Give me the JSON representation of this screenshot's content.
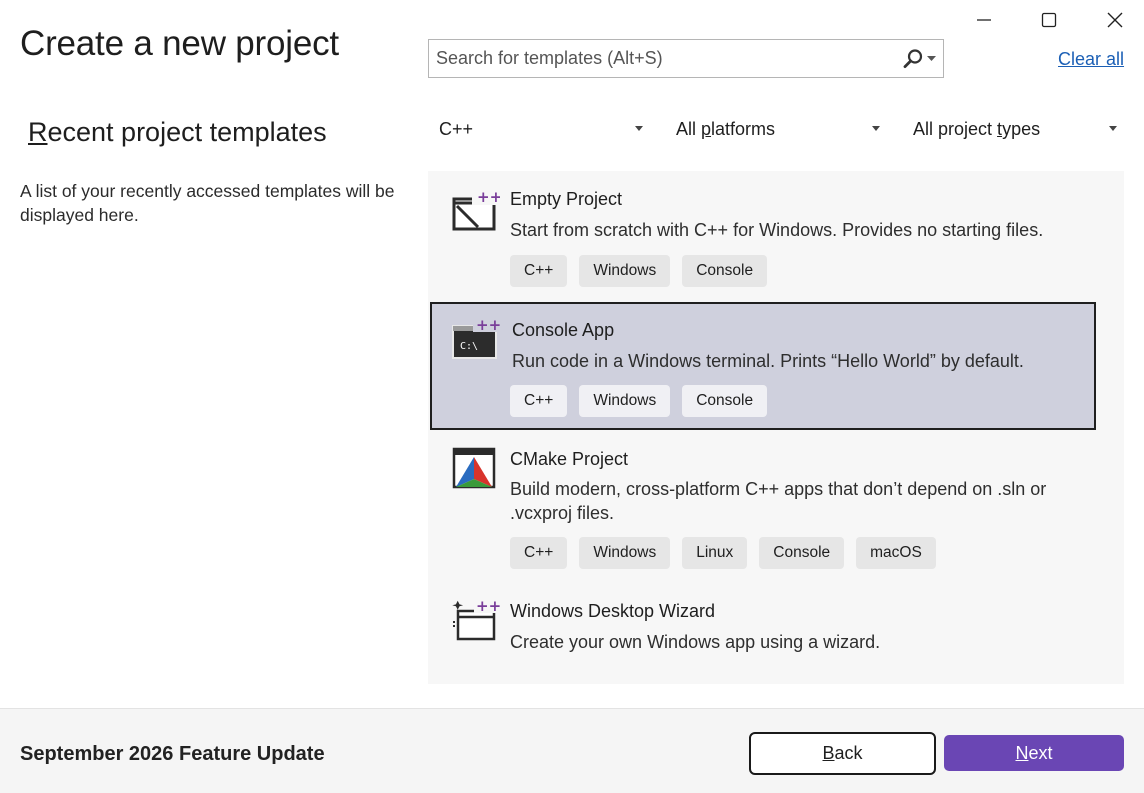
{
  "window": {
    "minimize_icon": "minimize-icon",
    "maximize_icon": "maximize-icon",
    "close_icon": "close-icon"
  },
  "page": {
    "title": "Create a new project"
  },
  "search": {
    "placeholder": "Search for templates (Alt+S)",
    "value": "",
    "icon": "search-icon",
    "clear_all": "Clear all"
  },
  "recent": {
    "heading_first": "R",
    "heading_rest": "ecent project templates",
    "description": "A list of your recently accessed templates will be displayed here."
  },
  "filters": {
    "language": "C++",
    "platform_pre": "All ",
    "platform_ul": "p",
    "platform_post": "latforms",
    "type_pre": "All project ",
    "type_ul": "t",
    "type_post": "ypes"
  },
  "templates": [
    {
      "name": "Empty Project",
      "description": "Start from scratch with C++ for Windows. Provides no starting files.",
      "tags": [
        "C++",
        "Windows",
        "Console"
      ],
      "icon": "empty-project-icon"
    },
    {
      "name": "Console App",
      "description": "Run code in a Windows terminal. Prints “Hello World” by default.",
      "tags": [
        "C++",
        "Windows",
        "Console"
      ],
      "icon": "console-app-icon"
    },
    {
      "name": "CMake Project",
      "description": "Build modern, cross-platform C++ apps that don’t depend on .sln or .vcxproj files.",
      "tags": [
        "C++",
        "Windows",
        "Linux",
        "Console",
        "macOS"
      ],
      "icon": "cmake-icon"
    },
    {
      "name": "Windows Desktop Wizard",
      "description": "Create your own Windows app using a wizard.",
      "icon": "wizard-icon"
    }
  ],
  "footer": {
    "update_label": "September 2026 Feature Update",
    "back_ul": "B",
    "back_rest": "ack",
    "next_ul": "N",
    "next_rest": "ext"
  },
  "colors": {
    "accent": "#6a46b4",
    "selection": "#cfd0dd",
    "link": "#1b5fb5"
  }
}
